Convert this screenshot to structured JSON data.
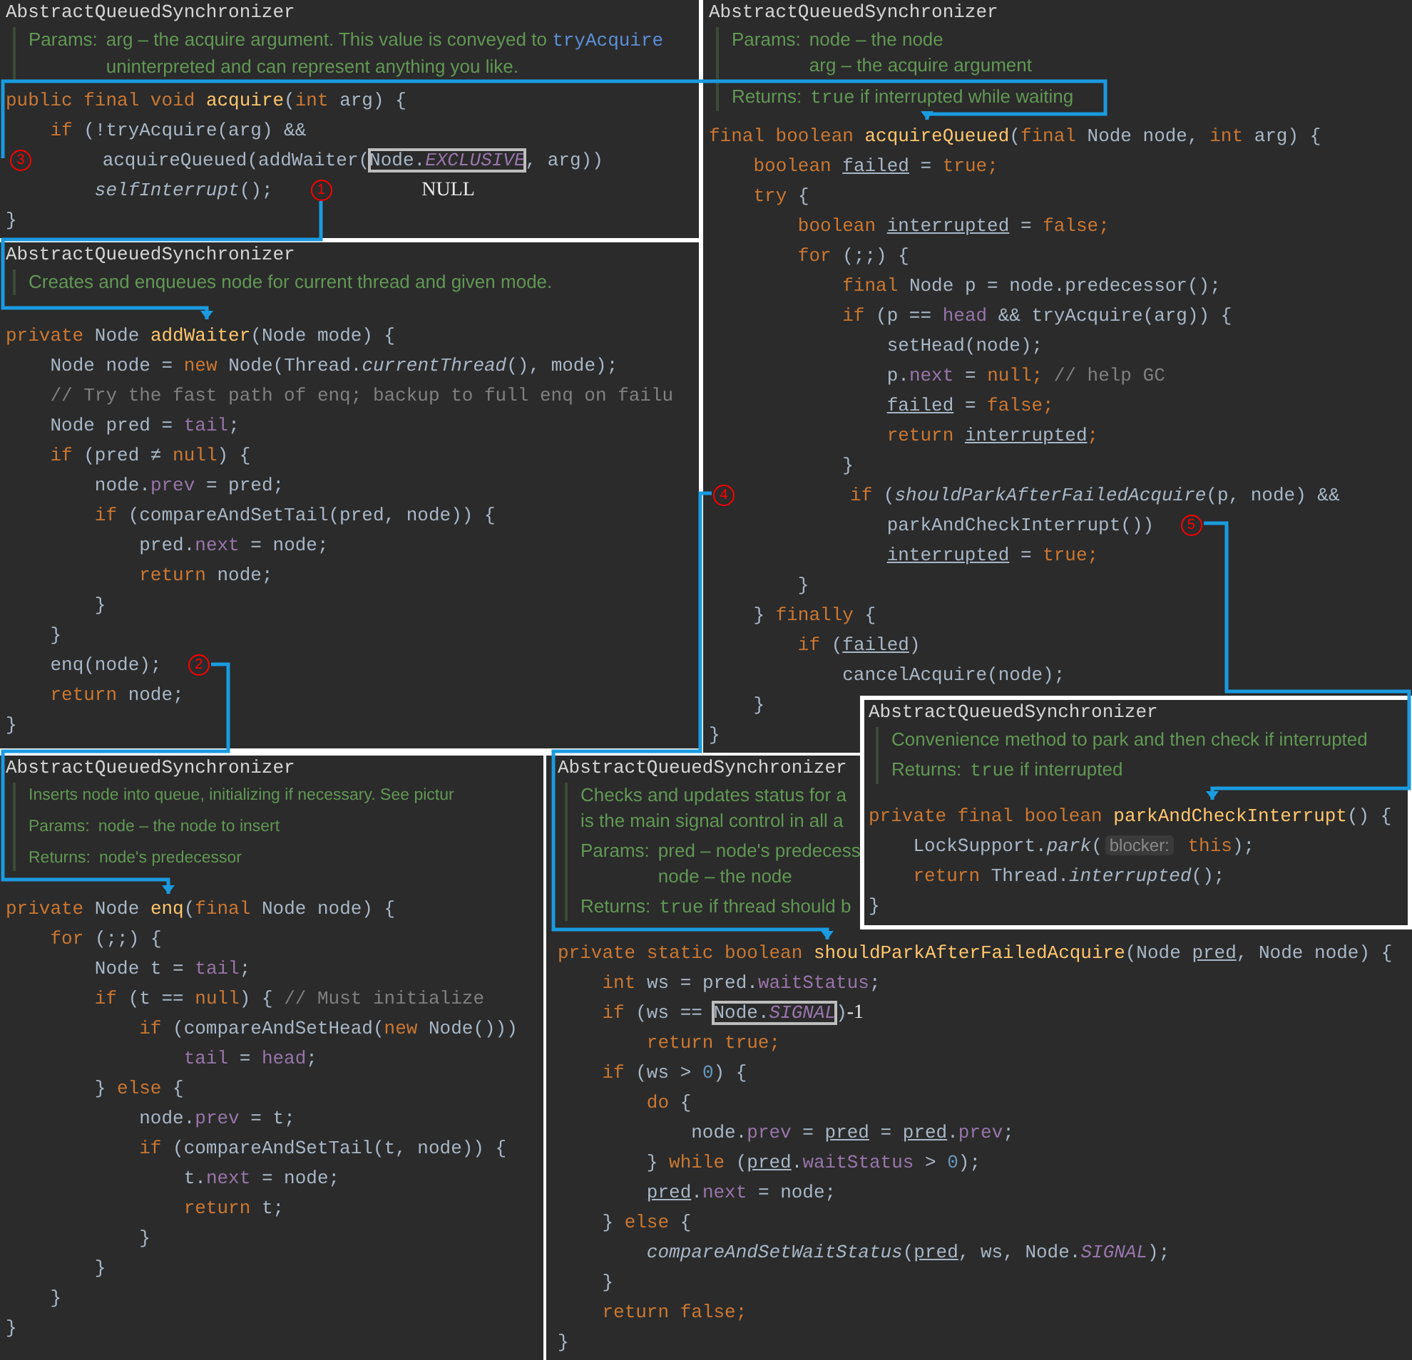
{
  "windows": [
    {
      "title": "AbstractQueuedSynchronizer",
      "doc": [
        {
          "label": "Params:",
          "lines": [
            [
              {
                "kind": "text",
                "text": "arg – the acquire argument. This value is conveyed to "
              },
              {
                "kind": "link",
                "text": "tryAcquire"
              }
            ],
            [
              {
                "kind": "text",
                "text": "uninterpreted and can represent anything you like."
              }
            ]
          ]
        }
      ],
      "code": [
        [
          {
            "kind": "kw",
            "text": "public final void "
          },
          {
            "kind": "decl",
            "text": "acquire"
          },
          {
            "kind": "plain",
            "text": "("
          },
          {
            "kind": "kw",
            "text": "int "
          },
          {
            "kind": "plain",
            "text": "arg) {"
          }
        ],
        [
          {
            "kind": "kw",
            "text": "    if "
          },
          {
            "kind": "plain",
            "text": "(!tryAcquire(arg) &&"
          }
        ],
        [
          {
            "kind": "marker",
            "text": "3"
          },
          {
            "kind": "plain",
            "text": "      acquireQueued(addWaiter("
          },
          {
            "kind": "boxed",
            "parts": [
              {
                "kind": "plain",
                "text": "Node."
              },
              {
                "kind": "static",
                "text": "EXCLUSIVE"
              }
            ]
          },
          {
            "kind": "plain",
            "text": ", arg))"
          }
        ],
        [
          {
            "kind": "italic",
            "text": "        selfInterrupt"
          },
          {
            "kind": "plain",
            "text": "();   "
          },
          {
            "kind": "marker",
            "text": "1"
          },
          {
            "kind": "aside",
            "text": "NULL"
          }
        ],
        [
          {
            "kind": "plain",
            "text": "}"
          }
        ]
      ]
    },
    {
      "title": "AbstractQueuedSynchronizer",
      "doc": [
        {
          "lines": [
            [
              {
                "kind": "text",
                "text": "Creates and enqueues node for current thread and given mode."
              }
            ]
          ]
        }
      ],
      "code": [
        [
          {
            "kind": "kw",
            "text": "private "
          },
          {
            "kind": "plain",
            "text": "Node "
          },
          {
            "kind": "decl",
            "text": "addWaiter"
          },
          {
            "kind": "plain",
            "text": "(Node mode) {"
          }
        ],
        [
          {
            "kind": "plain",
            "text": "    Node node = "
          },
          {
            "kind": "kw",
            "text": "new "
          },
          {
            "kind": "plain",
            "text": "Node(Thread."
          },
          {
            "kind": "italic",
            "text": "currentThread"
          },
          {
            "kind": "plain",
            "text": "(), mode);"
          }
        ],
        [
          {
            "kind": "comment",
            "text": "    // Try the fast path of enq; backup to full enq on failu"
          }
        ],
        [
          {
            "kind": "plain",
            "text": "    Node pred = "
          },
          {
            "kind": "field",
            "text": "tail"
          },
          {
            "kind": "plain",
            "text": ";"
          }
        ],
        [
          {
            "kind": "kw",
            "text": "    if "
          },
          {
            "kind": "plain",
            "text": "(pred ≠ "
          },
          {
            "kind": "kw",
            "text": "null"
          },
          {
            "kind": "plain",
            "text": ") {"
          }
        ],
        [
          {
            "kind": "plain",
            "text": "        node."
          },
          {
            "kind": "field",
            "text": "prev"
          },
          {
            "kind": "plain",
            "text": " = pred;"
          }
        ],
        [
          {
            "kind": "kw",
            "text": "        if "
          },
          {
            "kind": "plain",
            "text": "(compareAndSetTail(pred, node)) {"
          }
        ],
        [
          {
            "kind": "plain",
            "text": "            pred."
          },
          {
            "kind": "field",
            "text": "next"
          },
          {
            "kind": "plain",
            "text": " = node;"
          }
        ],
        [
          {
            "kind": "kw",
            "text": "            return "
          },
          {
            "kind": "plain",
            "text": "node;"
          }
        ],
        [
          {
            "kind": "plain",
            "text": "        }"
          }
        ],
        [
          {
            "kind": "plain",
            "text": "    }"
          }
        ],
        [
          {
            "kind": "plain",
            "text": "    enq(node);  "
          },
          {
            "kind": "marker",
            "text": "2"
          }
        ],
        [
          {
            "kind": "kw",
            "text": "    return "
          },
          {
            "kind": "plain",
            "text": "node;"
          }
        ],
        [
          {
            "kind": "plain",
            "text": "}"
          }
        ]
      ]
    },
    {
      "title": "AbstractQueuedSynchronizer",
      "doc": [
        {
          "label": "Params:",
          "lines": [
            [
              {
                "kind": "text",
                "text": "node – the node"
              }
            ],
            [
              {
                "kind": "text",
                "text": "arg – the acquire argument"
              }
            ]
          ]
        },
        {
          "label": "Returns:",
          "lines": [
            [
              {
                "kind": "code",
                "text": "true"
              },
              {
                "kind": "text",
                "text": " if interrupted while waiting"
              }
            ]
          ]
        }
      ],
      "code": [
        [
          {
            "kind": "kw",
            "text": "final boolean "
          },
          {
            "kind": "decl",
            "text": "acquireQueued"
          },
          {
            "kind": "plain",
            "text": "("
          },
          {
            "kind": "kw",
            "text": "final "
          },
          {
            "kind": "plain",
            "text": "Node node, "
          },
          {
            "kind": "kw",
            "text": "int "
          },
          {
            "kind": "plain",
            "text": "arg) {"
          }
        ],
        [
          {
            "kind": "kw",
            "text": "    boolean "
          },
          {
            "kind": "var",
            "text": "failed"
          },
          {
            "kind": "plain",
            "text": " = "
          },
          {
            "kind": "kw",
            "text": "true;"
          }
        ],
        [
          {
            "kind": "kw",
            "text": "    try "
          },
          {
            "kind": "plain",
            "text": "{"
          }
        ],
        [
          {
            "kind": "kw",
            "text": "        boolean "
          },
          {
            "kind": "var",
            "text": "interrupted"
          },
          {
            "kind": "plain",
            "text": " = "
          },
          {
            "kind": "kw",
            "text": "false;"
          }
        ],
        [
          {
            "kind": "kw",
            "text": "        for "
          },
          {
            "kind": "plain",
            "text": "(;;) {"
          }
        ],
        [
          {
            "kind": "kw",
            "text": "            final "
          },
          {
            "kind": "plain",
            "text": "Node p = node.predecessor();"
          }
        ],
        [
          {
            "kind": "kw",
            "text": "            if "
          },
          {
            "kind": "plain",
            "text": "(p == "
          },
          {
            "kind": "field",
            "text": "head"
          },
          {
            "kind": "plain",
            "text": " && tryAcquire(arg)) {"
          }
        ],
        [
          {
            "kind": "plain",
            "text": "                setHead(node);"
          }
        ],
        [
          {
            "kind": "plain",
            "text": "                p."
          },
          {
            "kind": "field",
            "text": "next"
          },
          {
            "kind": "plain",
            "text": " = "
          },
          {
            "kind": "kw",
            "text": "null;"
          },
          {
            "kind": "comment",
            "text": " // help GC"
          }
        ],
        [
          {
            "kind": "var",
            "text": "                failed"
          },
          {
            "kind": "plain",
            "text": " = "
          },
          {
            "kind": "kw",
            "text": "false;"
          }
        ],
        [
          {
            "kind": "kw",
            "text": "                return "
          },
          {
            "kind": "var",
            "text": "interrupted"
          },
          {
            "kind": "kw",
            "text": ";"
          }
        ],
        [
          {
            "kind": "plain",
            "text": "            }"
          }
        ],
        [
          {
            "kind": "marker",
            "text": "4"
          },
          {
            "kind": "kw",
            "text": "          if "
          },
          {
            "kind": "plain",
            "text": "("
          },
          {
            "kind": "italic",
            "text": "shouldParkAfterFailedAcquire"
          },
          {
            "kind": "plain",
            "text": "(p, node) &&"
          }
        ],
        [
          {
            "kind": "plain",
            "text": "                parkAndCheckInterrupt())  "
          },
          {
            "kind": "marker",
            "text": "5"
          }
        ],
        [
          {
            "kind": "var",
            "text": "                interrupted"
          },
          {
            "kind": "plain",
            "text": " = "
          },
          {
            "kind": "kw",
            "text": "true;"
          }
        ],
        [
          {
            "kind": "plain",
            "text": "        }"
          }
        ],
        [
          {
            "kind": "plain",
            "text": "    } "
          },
          {
            "kind": "kw",
            "text": "finally "
          },
          {
            "kind": "plain",
            "text": "{"
          }
        ],
        [
          {
            "kind": "kw",
            "text": "        if "
          },
          {
            "kind": "plain",
            "text": "("
          },
          {
            "kind": "var",
            "text": "failed"
          },
          {
            "kind": "plain",
            "text": ")"
          }
        ],
        [
          {
            "kind": "plain",
            "text": "            cancelAcquire(node);"
          }
        ],
        [
          {
            "kind": "plain",
            "text": "    }"
          }
        ],
        [
          {
            "kind": "plain",
            "text": "}"
          }
        ]
      ]
    },
    {
      "title": "AbstractQueuedSynchronizer",
      "doc": [
        {
          "lines": [
            [
              {
                "kind": "text",
                "text": "Inserts node into queue, initializing if necessary. See pictur"
              }
            ]
          ]
        },
        {
          "label": "Params:",
          "lines": [
            [
              {
                "kind": "text",
                "text": "node – the node to insert"
              }
            ]
          ]
        },
        {
          "label": "Returns:",
          "lines": [
            [
              {
                "kind": "text",
                "text": "node's predecessor"
              }
            ]
          ]
        }
      ],
      "code": [
        [
          {
            "kind": "kw",
            "text": "private "
          },
          {
            "kind": "plain",
            "text": "Node "
          },
          {
            "kind": "decl",
            "text": "enq"
          },
          {
            "kind": "plain",
            "text": "("
          },
          {
            "kind": "kw",
            "text": "final "
          },
          {
            "kind": "plain",
            "text": "Node node) {"
          }
        ],
        [
          {
            "kind": "kw",
            "text": "    for "
          },
          {
            "kind": "plain",
            "text": "(;;) {"
          }
        ],
        [
          {
            "kind": "plain",
            "text": "        Node t = "
          },
          {
            "kind": "field",
            "text": "tail"
          },
          {
            "kind": "plain",
            "text": ";"
          }
        ],
        [
          {
            "kind": "kw",
            "text": "        if "
          },
          {
            "kind": "plain",
            "text": "(t == "
          },
          {
            "kind": "kw",
            "text": "null"
          },
          {
            "kind": "plain",
            "text": ") { "
          },
          {
            "kind": "comment",
            "text": "// Must initialize"
          }
        ],
        [
          {
            "kind": "kw",
            "text": "            if "
          },
          {
            "kind": "plain",
            "text": "(compareAndSetHead("
          },
          {
            "kind": "kw",
            "text": "new "
          },
          {
            "kind": "plain",
            "text": "Node()))"
          }
        ],
        [
          {
            "kind": "field",
            "text": "                tail"
          },
          {
            "kind": "plain",
            "text": " = "
          },
          {
            "kind": "field",
            "text": "head"
          },
          {
            "kind": "plain",
            "text": ";"
          }
        ],
        [
          {
            "kind": "plain",
            "text": "        } "
          },
          {
            "kind": "kw",
            "text": "else "
          },
          {
            "kind": "plain",
            "text": "{"
          }
        ],
        [
          {
            "kind": "plain",
            "text": "            node."
          },
          {
            "kind": "field",
            "text": "prev"
          },
          {
            "kind": "plain",
            "text": " = t;"
          }
        ],
        [
          {
            "kind": "kw",
            "text": "            if "
          },
          {
            "kind": "plain",
            "text": "(compareAndSetTail(t, node)) {"
          }
        ],
        [
          {
            "kind": "plain",
            "text": "                t."
          },
          {
            "kind": "field",
            "text": "next"
          },
          {
            "kind": "plain",
            "text": " = node;"
          }
        ],
        [
          {
            "kind": "kw",
            "text": "                return "
          },
          {
            "kind": "plain",
            "text": "t;"
          }
        ],
        [
          {
            "kind": "plain",
            "text": "            }"
          }
        ],
        [
          {
            "kind": "plain",
            "text": "        }"
          }
        ],
        [
          {
            "kind": "plain",
            "text": "    }"
          }
        ],
        [
          {
            "kind": "plain",
            "text": "}"
          }
        ]
      ]
    },
    {
      "title": "AbstractQueuedSynchronizer",
      "doc": [
        {
          "lines": [
            [
              {
                "kind": "text",
                "text": "Checks and updates status for a"
              }
            ],
            [
              {
                "kind": "text",
                "text": "is the main signal control in all a"
              }
            ]
          ]
        },
        {
          "label": "Params:",
          "lines": [
            [
              {
                "kind": "text",
                "text": "pred – node's predecess"
              }
            ],
            [
              {
                "kind": "text",
                "text": "node – the node"
              }
            ]
          ]
        },
        {
          "label": "Returns:",
          "lines": [
            [
              {
                "kind": "code",
                "text": "true"
              },
              {
                "kind": "text",
                "text": " if thread should b"
              }
            ]
          ]
        }
      ],
      "code": [
        [
          {
            "kind": "kw",
            "text": "private static boolean "
          },
          {
            "kind": "decl",
            "text": "shouldParkAfterFailedAcquire"
          },
          {
            "kind": "plain",
            "text": "(Node "
          },
          {
            "kind": "var",
            "text": "pred"
          },
          {
            "kind": "plain",
            "text": ", Node node) {"
          }
        ],
        [
          {
            "kind": "kw",
            "text": "    int "
          },
          {
            "kind": "plain",
            "text": "ws = pred."
          },
          {
            "kind": "field",
            "text": "waitStatus"
          },
          {
            "kind": "plain",
            "text": ";"
          }
        ],
        [
          {
            "kind": "kw",
            "text": "    if "
          },
          {
            "kind": "plain",
            "text": "(ws == "
          },
          {
            "kind": "boxed",
            "parts": [
              {
                "kind": "plain",
                "text": "Node."
              },
              {
                "kind": "static",
                "text": "SIGNAL"
              }
            ]
          },
          {
            "kind": "plain",
            "text": ")"
          },
          {
            "kind": "note",
            "text": "-1"
          }
        ],
        [
          {
            "kind": "kw",
            "text": "        return true;"
          }
        ],
        [
          {
            "kind": "kw",
            "text": "    if "
          },
          {
            "kind": "plain",
            "text": "(ws > "
          },
          {
            "kind": "num",
            "text": "0"
          },
          {
            "kind": "plain",
            "text": ") {"
          }
        ],
        [
          {
            "kind": "kw",
            "text": "        do "
          },
          {
            "kind": "plain",
            "text": "{"
          }
        ],
        [
          {
            "kind": "plain",
            "text": "            node."
          },
          {
            "kind": "field",
            "text": "prev"
          },
          {
            "kind": "plain",
            "text": " = "
          },
          {
            "kind": "var",
            "text": "pred"
          },
          {
            "kind": "plain",
            "text": " = "
          },
          {
            "kind": "var",
            "text": "pred"
          },
          {
            "kind": "plain",
            "text": "."
          },
          {
            "kind": "field",
            "text": "prev"
          },
          {
            "kind": "plain",
            "text": ";"
          }
        ],
        [
          {
            "kind": "plain",
            "text": "        } "
          },
          {
            "kind": "kw",
            "text": "while "
          },
          {
            "kind": "plain",
            "text": "("
          },
          {
            "kind": "var",
            "text": "pred"
          },
          {
            "kind": "plain",
            "text": "."
          },
          {
            "kind": "field",
            "text": "waitStatus"
          },
          {
            "kind": "plain",
            "text": " > "
          },
          {
            "kind": "num",
            "text": "0"
          },
          {
            "kind": "plain",
            "text": ");"
          }
        ],
        [
          {
            "kind": "var",
            "text": "        pred"
          },
          {
            "kind": "plain",
            "text": "."
          },
          {
            "kind": "field",
            "text": "next"
          },
          {
            "kind": "plain",
            "text": " = node;"
          }
        ],
        [
          {
            "kind": "plain",
            "text": "    } "
          },
          {
            "kind": "kw",
            "text": "else "
          },
          {
            "kind": "plain",
            "text": "{"
          }
        ],
        [
          {
            "kind": "italic",
            "text": "        compareAndSetWaitStatus"
          },
          {
            "kind": "plain",
            "text": "("
          },
          {
            "kind": "var",
            "text": "pred"
          },
          {
            "kind": "plain",
            "text": ", ws, Node."
          },
          {
            "kind": "static",
            "text": "SIGNAL"
          },
          {
            "kind": "plain",
            "text": ");"
          }
        ],
        [
          {
            "kind": "plain",
            "text": "    }"
          }
        ],
        [
          {
            "kind": "kw",
            "text": "    return false;"
          }
        ],
        [
          {
            "kind": "plain",
            "text": "}"
          }
        ]
      ]
    },
    {
      "title": "AbstractQueuedSynchronizer",
      "doc": [
        {
          "lines": [
            [
              {
                "kind": "text",
                "text": "Convenience method to park and then check if interrupted"
              }
            ]
          ]
        },
        {
          "label": "Returns:",
          "lines": [
            [
              {
                "kind": "code",
                "text": "true"
              },
              {
                "kind": "text",
                "text": " if interrupted"
              }
            ]
          ]
        }
      ],
      "code": [
        [
          {
            "kind": "kw",
            "text": "private final boolean "
          },
          {
            "kind": "decl",
            "text": "parkAndCheckInterrupt"
          },
          {
            "kind": "plain",
            "text": "() {"
          }
        ],
        [
          {
            "kind": "plain",
            "text": "    LockSupport."
          },
          {
            "kind": "italic",
            "text": "park"
          },
          {
            "kind": "plain",
            "text": "("
          },
          {
            "kind": "hint",
            "text": "blocker:"
          },
          {
            "kind": "kw",
            "text": " this"
          },
          {
            "kind": "plain",
            "text": ");"
          }
        ],
        [
          {
            "kind": "kw",
            "text": "    return "
          },
          {
            "kind": "plain",
            "text": "Thread."
          },
          {
            "kind": "italic",
            "text": "interrupted"
          },
          {
            "kind": "plain",
            "text": "();"
          }
        ],
        [
          {
            "kind": "plain",
            "text": "}"
          }
        ]
      ]
    }
  ]
}
